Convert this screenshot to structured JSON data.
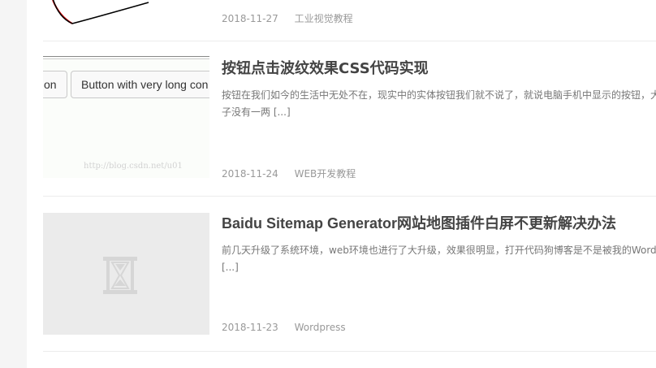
{
  "posts": [
    {
      "date": "2018-11-27",
      "category": "工业视觉教程"
    },
    {
      "title": "按钮点击波纹效果CSS代码实现",
      "excerpt_line1": "按钮在我们如今的生活中无处不在，现实中的实体按钮我们就不说了，就说电脑手机中显示的按钮，大",
      "excerpt_line2": "子没有一两 [...]",
      "date": "2018-11-24",
      "category": "WEB开发教程",
      "thumb": {
        "button1": "on",
        "button2": "Button with very long con",
        "watermark": "http://blog.csdn.net/u01"
      }
    },
    {
      "title": "Baidu Sitemap Generator网站地图插件白屏不更新解决办法",
      "excerpt_line1": "前几天升级了系统环境，web环境也进行了大升级，效果很明显，打开代码狗博客是不是被我的WordPr",
      "excerpt_line2": "[...]",
      "date": "2018-11-23",
      "category": "Wordpress",
      "thumb": {
        "icon": "hourglass-placeholder-icon"
      }
    }
  ]
}
